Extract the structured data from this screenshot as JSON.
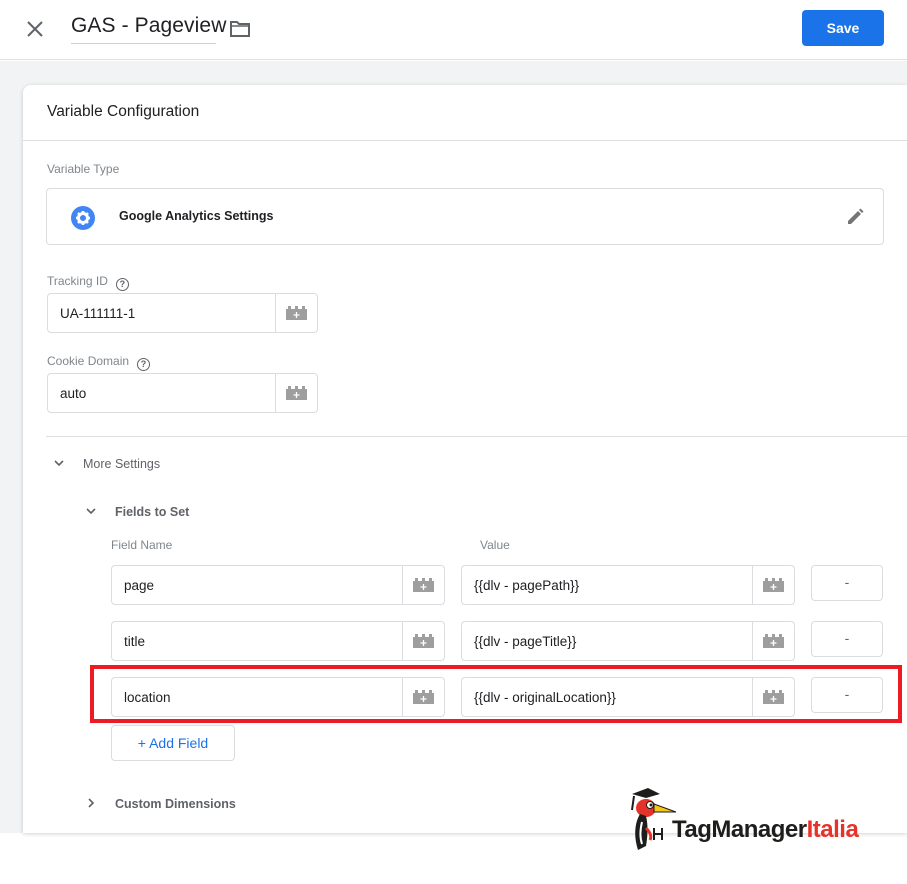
{
  "header": {
    "title": "GAS - Pageview",
    "save_label": "Save",
    "close_icon": "close-icon",
    "folder_icon": "folder-icon"
  },
  "card": {
    "title": "Variable Configuration",
    "variable_type_label": "Variable Type",
    "variable_type": {
      "name": "Google Analytics Settings",
      "icon": "gear-icon",
      "edit_icon": "pencil-icon"
    },
    "tracking_id": {
      "label": "Tracking ID",
      "help": "?",
      "value": "UA-111111-1"
    },
    "cookie_domain": {
      "label": "Cookie Domain",
      "help": "?",
      "value": "auto"
    },
    "more_settings": {
      "label": "More Settings",
      "expanded": true,
      "fields_to_set": {
        "label": "Fields to Set",
        "expanded": true,
        "column_headers": {
          "field_name": "Field Name",
          "value": "Value"
        },
        "rows": [
          {
            "field": "page",
            "value": "{{dlv - pagePath}}",
            "remove_label": "-"
          },
          {
            "field": "title",
            "value": "{{dlv - pageTitle}}",
            "remove_label": "-"
          },
          {
            "field": "location",
            "value": "{{dlv - originalLocation}}",
            "remove_label": "-",
            "highlighted": true
          }
        ],
        "add_field_label": "+ Add Field"
      },
      "custom_dimensions": {
        "label": "Custom Dimensions",
        "expanded": false
      }
    }
  },
  "watermark": {
    "brand_part1": "TagManager",
    "brand_part2": "Italia",
    "colors": {
      "part1": "#1d1d1b",
      "part2": "#e6332a"
    }
  },
  "colors": {
    "accent": "#1a73e8",
    "highlight": "#ec1c24",
    "background": "#f1f3f4"
  }
}
